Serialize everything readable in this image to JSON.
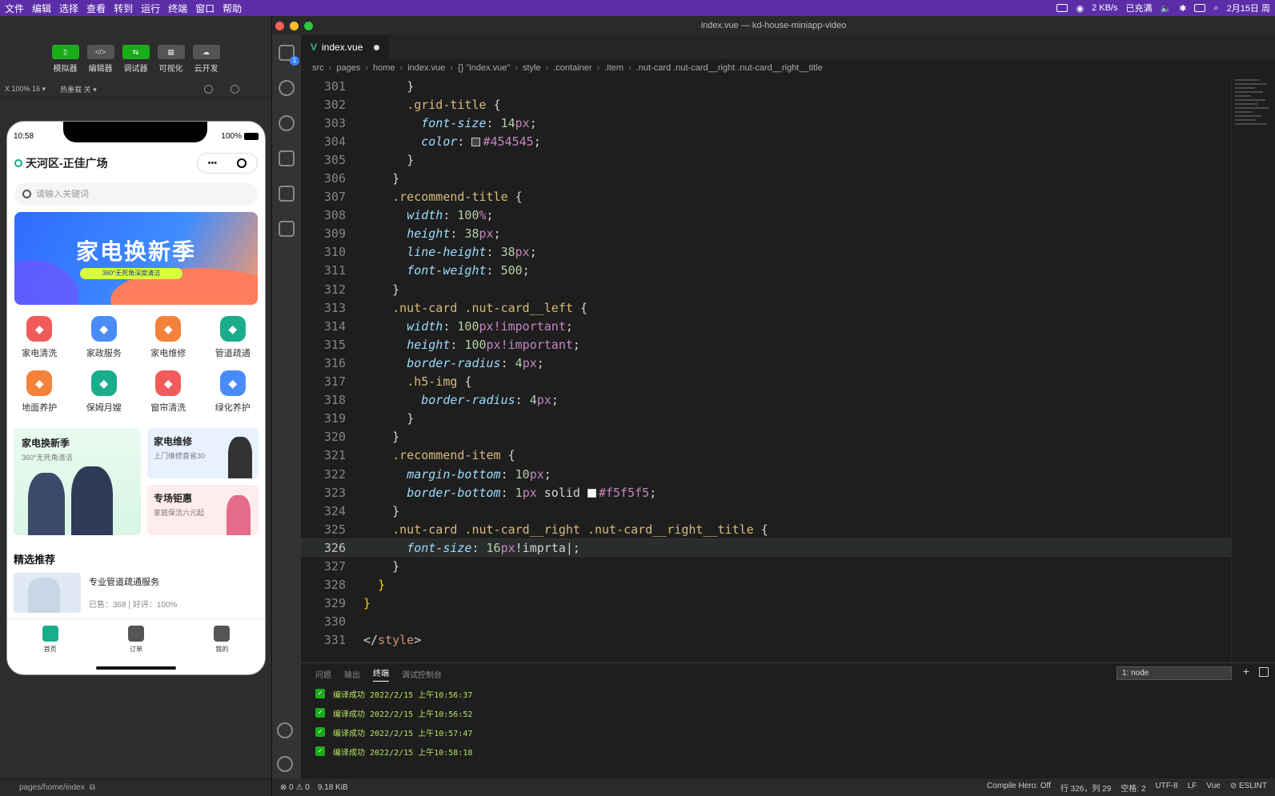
{
  "menubar": {
    "menus": [
      "文件",
      "编辑",
      "选择",
      "查看",
      "转到",
      "运行",
      "终端",
      "窗口",
      "帮助"
    ],
    "net": "2 KB/s",
    "charging": "已充满",
    "date": "2月15日 周"
  },
  "devtools": {
    "tools": [
      {
        "label": "模拟器",
        "glyph": "▯",
        "active": true
      },
      {
        "label": "编辑器",
        "glyph": "</>",
        "active": false
      },
      {
        "label": "调试器",
        "glyph": "⇆",
        "active": true
      },
      {
        "label": "可视化",
        "glyph": "▦",
        "active": false
      },
      {
        "label": "云开发",
        "glyph": "☁",
        "active": false
      }
    ],
    "zoom": "X 100% 16 ▾",
    "hot_reload": "热重载 关 ▾",
    "path": "pages/home/index"
  },
  "phone": {
    "time": "10:58",
    "battery": "100%",
    "location": "天河区-正佳广场",
    "capsule_dots": "•••",
    "search_placeholder": "请输入关键词",
    "banner_title": "家电换新季",
    "banner_tag": "360°无死角深度清洁",
    "grid": [
      {
        "label": "家电清洗",
        "color": "#f25b5b"
      },
      {
        "label": "家政服务",
        "color": "#4a8cf7"
      },
      {
        "label": "家电维修",
        "color": "#f5823a"
      },
      {
        "label": "管道疏通",
        "color": "#1aad8c"
      },
      {
        "label": "地面养护",
        "color": "#f5823a"
      },
      {
        "label": "保姆月嫂",
        "color": "#1aad8c"
      },
      {
        "label": "窗帘清洗",
        "color": "#f25b5b"
      },
      {
        "label": "绿化养护",
        "color": "#4a8cf7"
      }
    ],
    "promo_big": {
      "title": "家电换新季",
      "sub": "360°无死角清洁"
    },
    "promo_a": {
      "title": "家电维修",
      "sub": "上门维修直省30"
    },
    "promo_b": {
      "title": "专场钜惠",
      "sub": "家庭保洁六元起"
    },
    "section_title": "精选推荐",
    "rec_name": "专业管道疏通服务",
    "rec_meta": "已售：368 | 好评：100%",
    "tabs": [
      "首页",
      "订单",
      "我的"
    ]
  },
  "vscode": {
    "title": "index.vue — kd-house-miniapp-video",
    "tab": "index.vue",
    "breadcrumb": [
      "src",
      "pages",
      "home",
      "index.vue",
      "{} \"index.vue\"",
      "style",
      ".container",
      ".item",
      ".nut-card .nut-card__right .nut-card__right__title"
    ],
    "panel_tabs": [
      "问题",
      "输出",
      "终端",
      "调试控制台"
    ],
    "terminal_select": "1: node",
    "terminal_lines": [
      "编译成功 2022/2/15 上午10:56:37",
      "编译成功 2022/2/15 上午10:56:52",
      "编译成功 2022/2/15 上午10:57:47",
      "编译成功 2022/2/15 上午10:58:18"
    ],
    "status_left": [
      "⊗ 0 ⚠ 0",
      "9.18 KiB"
    ],
    "status_right": [
      "Compile Hero: Off",
      "行 326，列 29",
      "空格: 2",
      "UTF-8",
      "LF",
      "Vue",
      "⊘ ESLINT"
    ]
  },
  "code_lines": [
    {
      "n": "301",
      "html": "      <span class='punc'>}</span>"
    },
    {
      "n": "302",
      "html": "      <span class='sel'>.grid-title</span> <span class='punc'>{</span>"
    },
    {
      "n": "303",
      "html": "        <span class='prop'>font-size</span>: <span class='num'>14</span><span class='unit'>px</span>;"
    },
    {
      "n": "304",
      "html": "        <span class='prop'>color</span>: <span class='swatch' style='background:#454545'></span><span class='unit'>#454545</span>;"
    },
    {
      "n": "305",
      "html": "      <span class='punc'>}</span>"
    },
    {
      "n": "306",
      "html": "    <span class='punc'>}</span>"
    },
    {
      "n": "307",
      "html": "    <span class='sel'>.recommend-title</span> <span class='punc'>{</span>"
    },
    {
      "n": "308",
      "html": "      <span class='prop'>width</span>: <span class='num'>100</span><span class='unit'>%</span>;"
    },
    {
      "n": "309",
      "html": "      <span class='prop'>height</span>: <span class='num'>38</span><span class='unit'>px</span>;"
    },
    {
      "n": "310",
      "html": "      <span class='prop'>line-height</span>: <span class='num'>38</span><span class='unit'>px</span>;"
    },
    {
      "n": "311",
      "html": "      <span class='prop'>font-weight</span>: <span class='num'>500</span>;"
    },
    {
      "n": "312",
      "html": "    <span class='punc'>}</span>"
    },
    {
      "n": "313",
      "html": "    <span class='sel'>.nut-card .nut-card__left</span> <span class='punc'>{</span>"
    },
    {
      "n": "314",
      "html": "      <span class='prop'>width</span>: <span class='num'>100</span><span class='unit'>px</span><span class='imp'>!important</span>;"
    },
    {
      "n": "315",
      "html": "      <span class='prop'>height</span>: <span class='num'>100</span><span class='unit'>px</span><span class='imp'>!important</span>;"
    },
    {
      "n": "316",
      "html": "      <span class='prop'>border-radius</span>: <span class='num'>4</span><span class='unit'>px</span>;"
    },
    {
      "n": "317",
      "html": "      <span class='sel'>.h5-img</span> <span class='punc'>{</span>"
    },
    {
      "n": "318",
      "html": "        <span class='prop'>border-radius</span>: <span class='num'>4</span><span class='unit'>px</span>;"
    },
    {
      "n": "319",
      "html": "      <span class='punc'>}</span>"
    },
    {
      "n": "320",
      "html": "    <span class='punc'>}</span>"
    },
    {
      "n": "321",
      "html": "    <span class='sel'>.recommend-item</span> <span class='punc'>{</span>"
    },
    {
      "n": "322",
      "html": "      <span class='prop'>margin-bottom</span>: <span class='num'>10</span><span class='unit'>px</span>;"
    },
    {
      "n": "323",
      "html": "      <span class='prop'>border-bottom</span>: <span class='num'>1</span><span class='unit'>px</span> solid <span class='swatch' style='background:#f5f5f5'></span><span class='unit'>#f5f5f5</span>;"
    },
    {
      "n": "324",
      "html": "    <span class='punc'>}</span>"
    },
    {
      "n": "325",
      "html": "    <span class='sel'>.nut-card .nut-card__right .nut-card__right__title</span> <span class='punc'>{</span>"
    },
    {
      "n": "326",
      "html": "      <span class='prop'>font-size</span>: <span class='num'>16</span><span class='unit'>px</span>!imprta|;",
      "current": true
    },
    {
      "n": "327",
      "html": "    <span class='punc'>}</span>"
    },
    {
      "n": "328",
      "html": "  <span class='brace'>}</span>"
    },
    {
      "n": "329",
      "html": "<span class='brace'>}</span>"
    },
    {
      "n": "330",
      "html": ""
    },
    {
      "n": "331",
      "html": "<span class='punc'>&lt;/</span><span class='kw'>style</span><span class='punc'>&gt;</span>"
    }
  ]
}
